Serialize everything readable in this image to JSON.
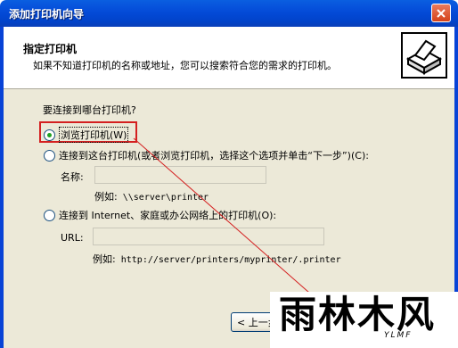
{
  "window": {
    "title": "添加打印机向导"
  },
  "header": {
    "title": "指定打印机",
    "subtitle": "如果不知道打印机的名称或地址，您可以搜索符合您的需求的打印机。"
  },
  "body": {
    "question": "要连接到哪台打印机?",
    "options": [
      {
        "label": "浏览打印机(W)",
        "checked": true
      },
      {
        "label": "连接到这台打印机(或者浏览打印机，选择这个选项并单击“下一步”)(C):",
        "checked": false
      },
      {
        "label": "连接到 Internet、家庭或办公网络上的打印机(O):",
        "checked": false
      }
    ],
    "name_label": "名称:",
    "name_value": "",
    "name_example_prefix": "例如:",
    "name_example": "\\\\server\\printer",
    "url_label": "URL:",
    "url_value": "",
    "url_example_prefix": "例如:",
    "url_example": "http://server/printers/myprinter/.printer"
  },
  "buttons": {
    "back": "< 上一步"
  },
  "watermark": {
    "text": "雨林木风",
    "sub": "YLMF"
  },
  "colors": {
    "highlight": "#d42020",
    "titlebar": "#0349d6"
  }
}
